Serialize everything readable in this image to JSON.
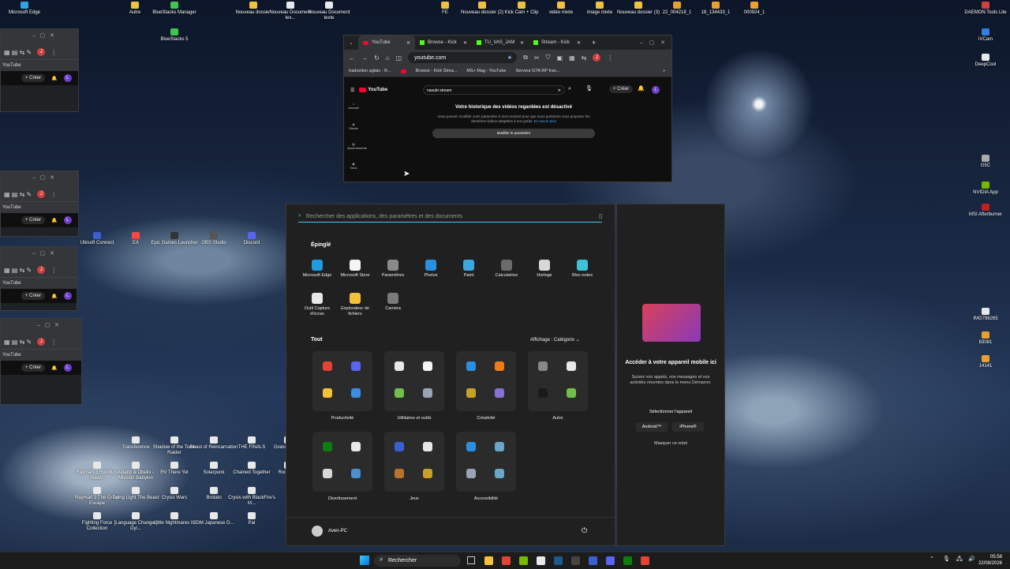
{
  "desktop": {
    "icons": [
      {
        "label": "Microsoft Edge",
        "color": "#2ea4e0"
      },
      {
        "label": "Autre",
        "color": "#f0c040"
      },
      {
        "label": "BlueStacks Manager",
        "color": "#3ec64e"
      },
      {
        "label": "BlueStacks 5",
        "color": "#3ec64e"
      },
      {
        "label": "Nouveau dossier",
        "color": "#f0c040"
      },
      {
        "label": "Nouveau Document tex...",
        "color": "#e8e8e8"
      },
      {
        "label": "Nouveau Document texte",
        "color": "#e8e8e8"
      },
      {
        "label": "FE",
        "color": "#f0c040"
      },
      {
        "label": "Nouveau dossier (2)",
        "color": "#f0c040"
      },
      {
        "label": "Kick Cam + Clip",
        "color": "#f0c040"
      },
      {
        "label": "vidéo mixte",
        "color": "#f0c040"
      },
      {
        "label": "image mixte",
        "color": "#f0c040"
      },
      {
        "label": "Nouveau dossier (3)",
        "color": "#f0c040"
      },
      {
        "label": "22_004218_1",
        "color": "#e8a030"
      },
      {
        "label": "18_134433_1",
        "color": "#e8a030"
      },
      {
        "label": "000924_1",
        "color": "#e8a030"
      },
      {
        "label": "DAEMON Tools Lite",
        "color": "#d04040"
      },
      {
        "label": "iVCam",
        "color": "#3080e0"
      },
      {
        "label": "DeepCool",
        "color": "#e8e8e8"
      },
      {
        "label": "Ubisoft Connect",
        "color": "#3a60d0"
      },
      {
        "label": "EA",
        "color": "#ff4747"
      },
      {
        "label": "Epic Games Launcher",
        "color": "#333"
      },
      {
        "label": "OBS Studio",
        "color": "#555"
      },
      {
        "label": "Discord",
        "color": "#5865f2"
      },
      {
        "label": "G5C",
        "color": "#aaa"
      },
      {
        "label": "NVIDIA App",
        "color": "#76b900"
      },
      {
        "label": "MSI Afterburner",
        "color": "#c02020"
      },
      {
        "label": "IMG796265",
        "color": "#e8e8e8"
      },
      {
        "label": "83081",
        "color": "#e8a030"
      },
      {
        "label": "14141",
        "color": "#e8a030"
      },
      {
        "label": "Transference",
        "color": "#e8e8e8"
      },
      {
        "label": "Shadow of the Tomb Raider",
        "color": "#e8e8e8"
      },
      {
        "label": "Beast of Reincarnation",
        "color": "#e8e8e8"
      },
      {
        "label": "THE FINALS",
        "color": "#e8e8e8"
      },
      {
        "label": "Grand V Vers",
        "color": "#e8e8e8"
      },
      {
        "label": "Rayman 3 Hoodlum Havoc",
        "color": "#e8e8e8"
      },
      {
        "label": "Asterix & Obelix - Mission Babylon",
        "color": "#e8e8e8"
      },
      {
        "label": "RV There Yet",
        "color": "#e8e8e8"
      },
      {
        "label": "Solarpunk",
        "color": "#e8e8e8"
      },
      {
        "label": "Chained Together",
        "color": "#e8e8e8"
      },
      {
        "label": "Rocks La",
        "color": "#e8e8e8"
      },
      {
        "label": "Rayman 2 The Great Escape",
        "color": "#e8e8e8"
      },
      {
        "label": "Dying Light The Beast",
        "color": "#e8e8e8"
      },
      {
        "label": "Crysis Wars",
        "color": "#e8e8e8"
      },
      {
        "label": "Brotato",
        "color": "#e8e8e8"
      },
      {
        "label": "Crysis with BlackFire's M...",
        "color": "#e8e8e8"
      },
      {
        "label": "Fighting Force Collection",
        "color": "#e8e8e8"
      },
      {
        "label": "[Language Changer] Dyi...",
        "color": "#e8e8e8"
      },
      {
        "label": "Little Nightmares III",
        "color": "#e8e8e8"
      },
      {
        "label": "JDM Japanese D...",
        "color": "#e8e8e8"
      },
      {
        "label": "Pal",
        "color": "#e8e8e8"
      }
    ]
  },
  "bg_windows": {
    "yt_label": "YouTube",
    "create": "+ Créer",
    "avatar": "L"
  },
  "browser": {
    "tabs": [
      "YouTube",
      "Browse - Kick",
      "TU_VAS_JAM",
      "Stream - Kick"
    ],
    "url": "youtube.com",
    "bookmarks": [
      "traduction aglais - R...",
      "Browse - Kick Strea...",
      "MS+ Mag - YouTube",
      "Serveur GTA RP fran..."
    ],
    "yt": {
      "logo": "YouTube",
      "search_value": "nasubi stream",
      "create": "+ Créer",
      "avatar": "L",
      "nav": [
        "Accueil",
        "Shorts",
        "Abonnements",
        "Vous"
      ],
      "history_title": "Votre historique des vidéos regardées est désactivé",
      "history_desc": "Vous pouvez modifier votre paramètre à tout moment pour que nous puissions vous proposer les dernières vidéos adaptées à vos goûts.",
      "history_link": "En savoir plus",
      "history_button": "Modifier le paramètre"
    }
  },
  "start_menu": {
    "search_placeholder": "Rechercher des applications, des paramètres et des documents",
    "pinned_title": "Épinglé",
    "pinned": [
      {
        "label": "Microsoft Edge",
        "color": "#1f9bde"
      },
      {
        "label": "Microsoft Store",
        "color": "#f4f4f4"
      },
      {
        "label": "Paramètres",
        "color": "#8a8a8a"
      },
      {
        "label": "Photos",
        "color": "#2b8fe0"
      },
      {
        "label": "Paint",
        "color": "#3aa7e0"
      },
      {
        "label": "Calculatrice",
        "color": "#6b6b6b"
      },
      {
        "label": "Horloge",
        "color": "#d8d8d8"
      },
      {
        "label": "Bloc-notes",
        "color": "#3fc2d8"
      },
      {
        "label": "Outil Capture d'écran",
        "color": "#e8e8e8"
      },
      {
        "label": "Explorateur de fichiers",
        "color": "#f3c13a"
      },
      {
        "label": "Caméra",
        "color": "#7a7a7a"
      }
    ],
    "all_title": "Tout",
    "view_label": "Affichage : Catégorie",
    "categories": [
      {
        "label": "Productivité",
        "colors": [
          "#e34234",
          "#5865f2",
          "#f3c13a",
          "#3c8de0"
        ]
      },
      {
        "label": "Utilitaires et outils",
        "colors": [
          "#e8e8e8",
          "#f4f4f4",
          "#6fbf4a",
          "#9aa3b5"
        ]
      },
      {
        "label": "Créativité",
        "colors": [
          "#2b8fe0",
          "#f07b17",
          "#c8a028",
          "#8870d8"
        ]
      },
      {
        "label": "Autre",
        "colors": [
          "#888",
          "#e8e8e8",
          "#1a1a1a",
          "#6fbf4a"
        ]
      },
      {
        "label": "Divertissement",
        "colors": [
          "#107c10",
          "#e8e8e8",
          "#d8d8d8",
          "#4a8fd0"
        ]
      },
      {
        "label": "Jeux",
        "colors": [
          "#3a60d0",
          "#e8e8e8",
          "#b8722e",
          "#c8a028"
        ]
      },
      {
        "label": "Accessibilité",
        "colors": [
          "#2b8fe0",
          "#6aa6c8",
          "#9aa3b5",
          "#6aa6c8"
        ]
      }
    ],
    "user": "Aven-PC"
  },
  "phone_panel": {
    "title": "Accéder à votre appareil mobile ici",
    "desc": "Suivez vos appels, vos messages et vos activités récentes dans le menu Démarrer.",
    "select": "Sélectionner l'appareil",
    "android": "Android™",
    "iphone": "iPhone®",
    "hide": "Masquer ce volet"
  },
  "taskbar": {
    "search": "Rechercher",
    "time": "05:58",
    "date": "22/08/2026",
    "apps": [
      {
        "name": "file-explorer",
        "color": "#f3c13a"
      },
      {
        "name": "chrome",
        "color": "#e34234"
      },
      {
        "name": "nvidia",
        "color": "#76b900"
      },
      {
        "name": "notepad",
        "color": "#e8e8e8"
      },
      {
        "name": "steam",
        "color": "#1b5a8a"
      },
      {
        "name": "obs",
        "color": "#444"
      },
      {
        "name": "ubisoft",
        "color": "#3a60d0"
      },
      {
        "name": "discord",
        "color": "#5865f2"
      },
      {
        "name": "xbox",
        "color": "#107c10"
      },
      {
        "name": "chrome-2",
        "color": "#e34234"
      }
    ]
  }
}
